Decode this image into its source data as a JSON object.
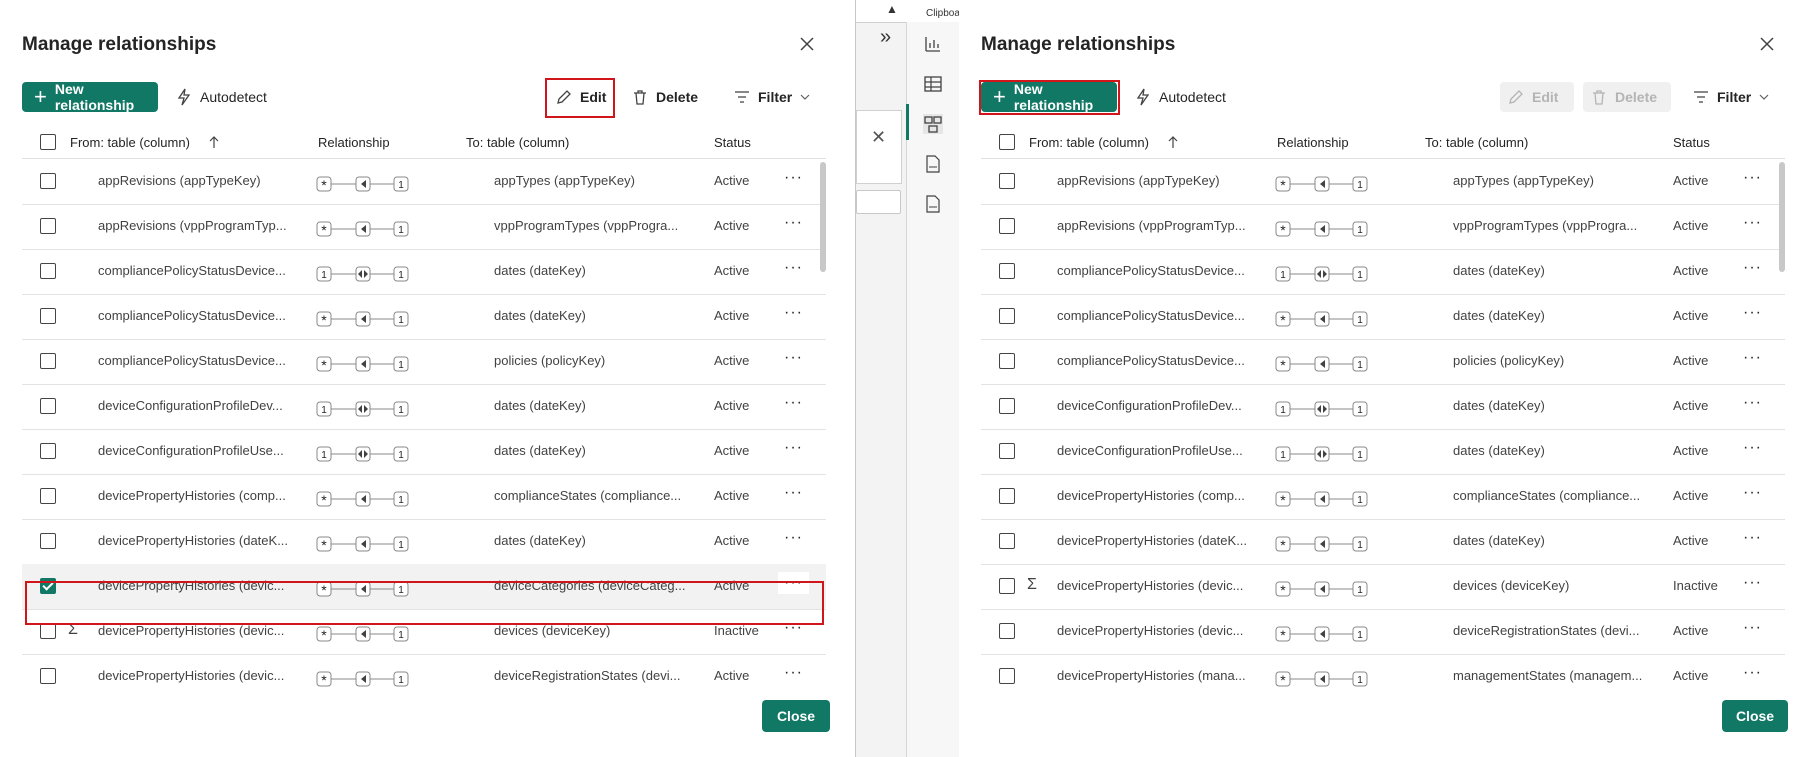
{
  "left_dialog": {
    "title": "Manage relationships",
    "toolbar": {
      "new_relationship": "New relationship",
      "autodetect": "Autodetect",
      "edit": "Edit",
      "delete": "Delete",
      "filter": "Filter"
    },
    "columns": {
      "from": "From: table (column)",
      "relationship": "Relationship",
      "to": "To: table (column)",
      "status": "Status"
    },
    "rows": [
      {
        "from": "appRevisions (appTypeKey)",
        "card": "many-one",
        "to": "appTypes (appTypeKey)",
        "status": "Active",
        "checked": false,
        "sigma": false
      },
      {
        "from": "appRevisions (vppProgramTyp...",
        "card": "many-one",
        "to": "vppProgramTypes (vppProgra...",
        "status": "Active",
        "checked": false,
        "sigma": false
      },
      {
        "from": "compliancePolicyStatusDevice...",
        "card": "one-one",
        "to": "dates (dateKey)",
        "status": "Active",
        "checked": false,
        "sigma": false
      },
      {
        "from": "compliancePolicyStatusDevice...",
        "card": "many-one",
        "to": "dates (dateKey)",
        "status": "Active",
        "checked": false,
        "sigma": false
      },
      {
        "from": "compliancePolicyStatusDevice...",
        "card": "many-one",
        "to": "policies (policyKey)",
        "status": "Active",
        "checked": false,
        "sigma": false
      },
      {
        "from": "deviceConfigurationProfileDev...",
        "card": "one-one",
        "to": "dates (dateKey)",
        "status": "Active",
        "checked": false,
        "sigma": false
      },
      {
        "from": "deviceConfigurationProfileUse...",
        "card": "one-one",
        "to": "dates (dateKey)",
        "status": "Active",
        "checked": false,
        "sigma": false
      },
      {
        "from": "devicePropertyHistories (comp...",
        "card": "many-one",
        "to": "complianceStates (compliance...",
        "status": "Active",
        "checked": false,
        "sigma": false
      },
      {
        "from": "devicePropertyHistories (dateK...",
        "card": "many-one",
        "to": "dates (dateKey)",
        "status": "Active",
        "checked": false,
        "sigma": false
      },
      {
        "from": "devicePropertyHistories (devic...",
        "card": "many-one",
        "to": "deviceCategories (deviceCateg...",
        "status": "Active",
        "checked": true,
        "sigma": false
      },
      {
        "from": "devicePropertyHistories (devic...",
        "card": "many-one",
        "to": "devices (deviceKey)",
        "status": "Inactive",
        "checked": false,
        "sigma": true
      },
      {
        "from": "devicePropertyHistories (devic...",
        "card": "many-one",
        "to": "deviceRegistrationStates (devi...",
        "status": "Active",
        "checked": false,
        "sigma": false
      }
    ],
    "close": "Close"
  },
  "right_dialog": {
    "title": "Manage relationships",
    "toolbar": {
      "new_relationship": "New relationship",
      "autodetect": "Autodetect",
      "edit": "Edit",
      "delete": "Delete",
      "filter": "Filter"
    },
    "columns": {
      "from": "From: table (column)",
      "relationship": "Relationship",
      "to": "To: table (column)",
      "status": "Status"
    },
    "rows": [
      {
        "from": "appRevisions (appTypeKey)",
        "card": "many-one",
        "to": "appTypes (appTypeKey)",
        "status": "Active",
        "checked": false,
        "sigma": false
      },
      {
        "from": "appRevisions (vppProgramTyp...",
        "card": "many-one",
        "to": "vppProgramTypes (vppProgra...",
        "status": "Active",
        "checked": false,
        "sigma": false
      },
      {
        "from": "compliancePolicyStatusDevice...",
        "card": "one-one",
        "to": "dates (dateKey)",
        "status": "Active",
        "checked": false,
        "sigma": false
      },
      {
        "from": "compliancePolicyStatusDevice...",
        "card": "many-one",
        "to": "dates (dateKey)",
        "status": "Active",
        "checked": false,
        "sigma": false
      },
      {
        "from": "compliancePolicyStatusDevice...",
        "card": "many-one",
        "to": "policies (policyKey)",
        "status": "Active",
        "checked": false,
        "sigma": false
      },
      {
        "from": "deviceConfigurationProfileDev...",
        "card": "one-one",
        "to": "dates (dateKey)",
        "status": "Active",
        "checked": false,
        "sigma": false
      },
      {
        "from": "deviceConfigurationProfileUse...",
        "card": "one-one",
        "to": "dates (dateKey)",
        "status": "Active",
        "checked": false,
        "sigma": false
      },
      {
        "from": "devicePropertyHistories (comp...",
        "card": "many-one",
        "to": "complianceStates (compliance...",
        "status": "Active",
        "checked": false,
        "sigma": false
      },
      {
        "from": "devicePropertyHistories (dateK...",
        "card": "many-one",
        "to": "dates (dateKey)",
        "status": "Active",
        "checked": false,
        "sigma": false
      },
      {
        "from": "devicePropertyHistories (devic...",
        "card": "many-one",
        "to": "devices (deviceKey)",
        "status": "Inactive",
        "checked": false,
        "sigma": true
      },
      {
        "from": "devicePropertyHistories (devic...",
        "card": "many-one",
        "to": "deviceRegistrationStates (devi...",
        "status": "Active",
        "checked": false,
        "sigma": false
      },
      {
        "from": "devicePropertyHistories (mana...",
        "card": "many-one",
        "to": "managementStates (managem...",
        "status": "Active",
        "checked": false,
        "sigma": false
      }
    ],
    "close": "Close"
  },
  "background_app": {
    "clipboard_label": "Clipboa"
  },
  "colors": {
    "accent": "#117865",
    "highlight": "#d0161b"
  }
}
